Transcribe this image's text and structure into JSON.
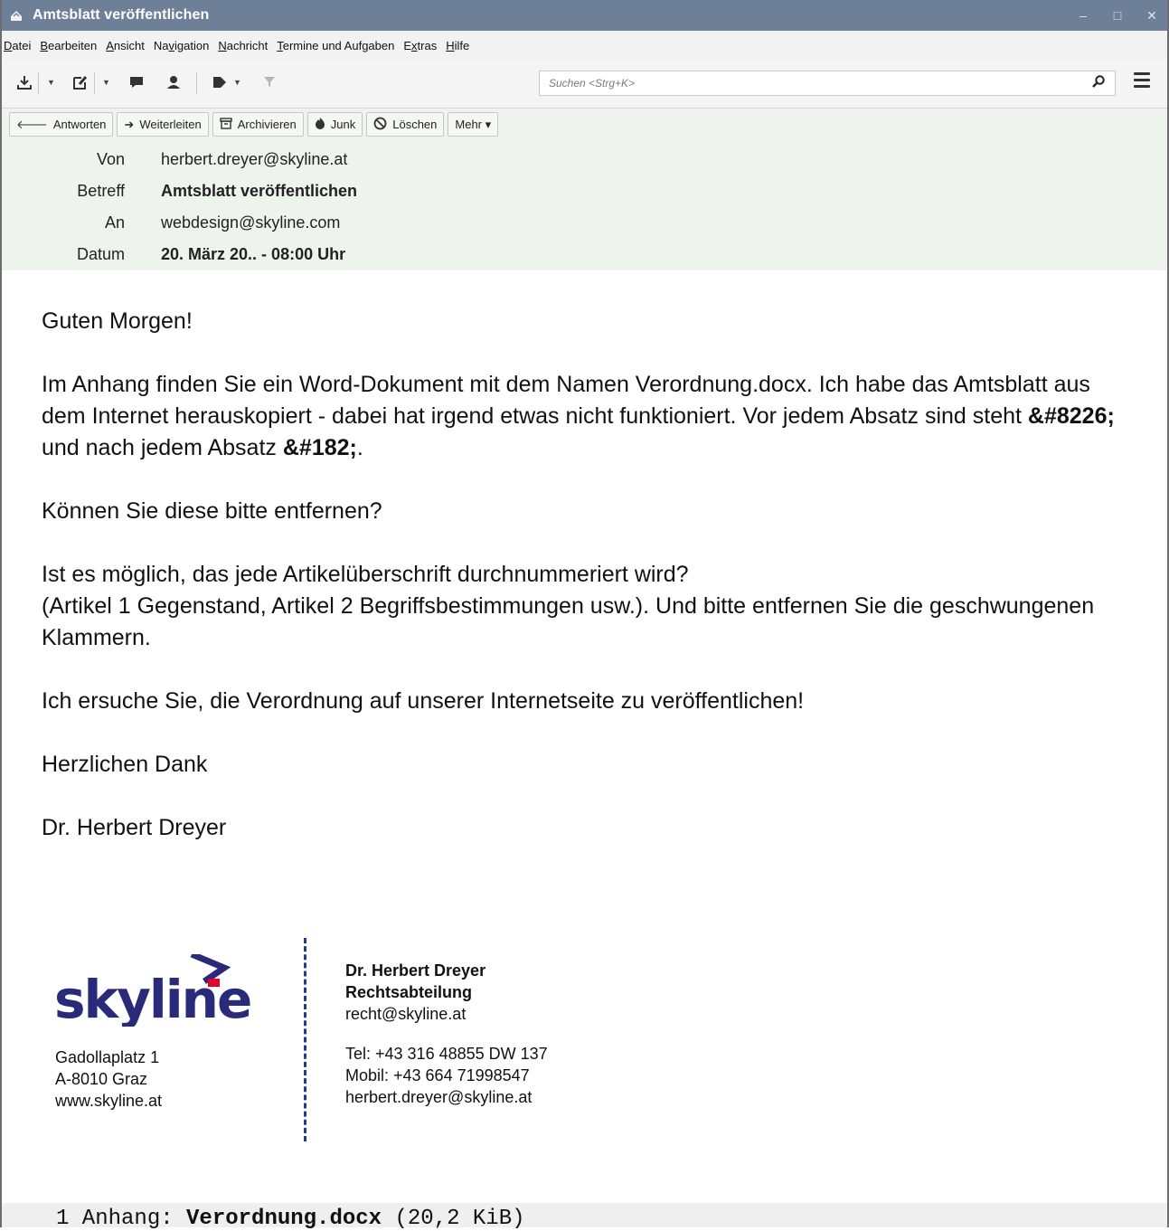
{
  "window": {
    "title": "Amtsblatt veröffentlichen",
    "buttons": [
      "–",
      "□",
      "✕"
    ]
  },
  "menubar": [
    {
      "acc": "D",
      "rest": "atei"
    },
    {
      "acc": "B",
      "rest": "earbeiten"
    },
    {
      "acc": "A",
      "rest": "nsicht"
    },
    {
      "pre": "Na",
      "acc": "v",
      "rest": "igation"
    },
    {
      "acc": "N",
      "rest": "achricht"
    },
    {
      "acc": "T",
      "rest": "ermine und Aufgaben"
    },
    {
      "pre": "E",
      "acc": "x",
      "rest": "tras"
    },
    {
      "acc": "H",
      "rest": "ilfe"
    }
  ],
  "search": {
    "placeholder": "Suchen <Strg+K>"
  },
  "actions": {
    "reply": "Antworten",
    "forward": "Weiterleiten",
    "archive": "Archivieren",
    "junk": "Junk",
    "delete": "Löschen",
    "more": "Mehr ▾"
  },
  "header": {
    "from_label": "Von",
    "from": "herbert.dreyer@skyline.at",
    "subject_label": "Betreff",
    "subject": "Amtsblatt veröffentlichen",
    "to_label": "An",
    "to": "webdesign@skyline.com",
    "date_label": "Datum",
    "date": "20. März 20.. - 08:00 Uhr"
  },
  "body": {
    "greeting": "Guten Morgen!",
    "p1_part1": "Im Anhang finden Sie ein Word-Dokument mit dem Namen Verordnung.docx. Ich habe das Amtsblatt aus dem Internet herauskopiert - dabei hat irgend etwas nicht funktioniert. Vor jedem Absatz sind steht ",
    "p1_code1": "&#8226;",
    "p1_part2": " und nach jedem Absatz ",
    "p1_code2": "&#182;",
    "p1_part3": ".",
    "p2": "Können Sie diese bitte entfernen?",
    "p3_line1": "Ist es möglich, das jede Artikelüberschrift durchnummeriert wird?",
    "p3_line2": "(Artikel 1 Gegenstand, Artikel 2 Begriffsbestimmungen usw.). Und bitte entfernen Sie die geschwungenen Klammern.",
    "p4": "Ich ersuche Sie, die Verordnung auf unserer Internetseite zu veröffentlichen!",
    "closing": "Herzlichen Dank",
    "name": "Dr. Herbert Dreyer"
  },
  "signature": {
    "logo": "skyline",
    "address": [
      "Gadollaplatz 1",
      "A-8010 Graz",
      "www.skyline.at"
    ],
    "name": "Dr. Herbert Dreyer",
    "department": "Rechtsabteilung",
    "email_dept": "recht@skyline.at",
    "tel": "Tel: +43 316 48855 DW 137",
    "mobile": "Mobil: +43 664 71998547",
    "email": "herbert.dreyer@skyline.at",
    "colors": {
      "brand_blue": "#2a2a7a",
      "accent_red": "#e4002b"
    }
  },
  "attachment": {
    "prefix": "1 Anhang: ",
    "filename": "Verordnung.docx",
    "size": " (20,2 KiB)"
  },
  "colors": {
    "titlebar": "#6e7f98",
    "header_bg": "#eef3ee"
  }
}
